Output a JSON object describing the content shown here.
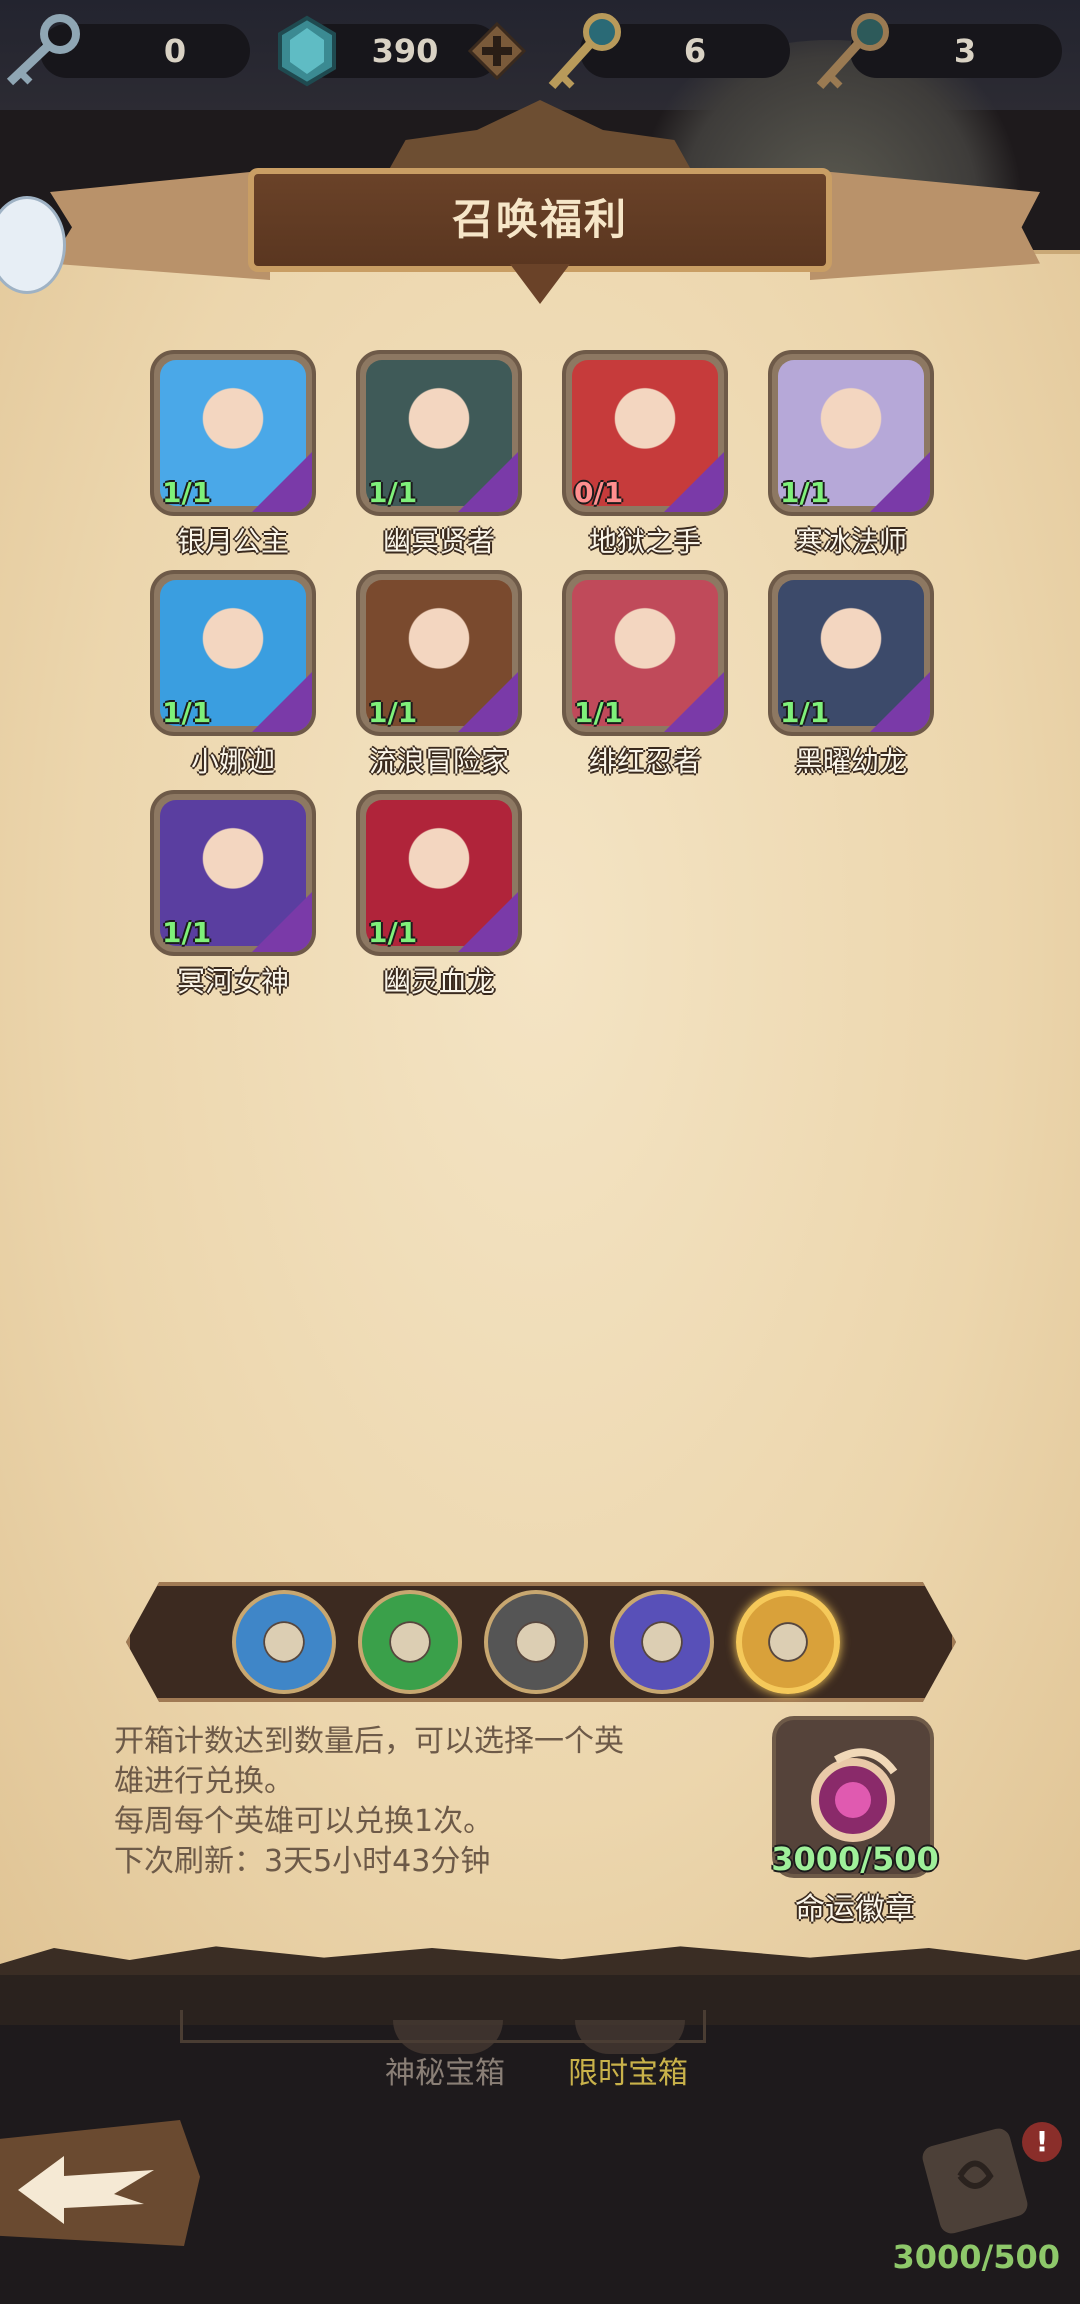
{
  "currencies": [
    {
      "icon": "silver-key-icon",
      "value": "0"
    },
    {
      "icon": "gem-icon",
      "value": "390"
    },
    {
      "icon": "teal-key-icon",
      "value": "6"
    },
    {
      "icon": "bronze-key-icon",
      "value": "3"
    }
  ],
  "banner": {
    "title": "召唤福利"
  },
  "heroes": [
    {
      "name": "银月公主",
      "count": "1/1",
      "color": "#4aa8e8"
    },
    {
      "name": "幽冥贤者",
      "count": "1/1",
      "color": "#3f5a58"
    },
    {
      "name": "地狱之手",
      "count": "0/1",
      "color": "#c63b3b"
    },
    {
      "name": "寒冰法师",
      "count": "1/1",
      "color": "#b6a8d8"
    },
    {
      "name": "小娜迦",
      "count": "1/1",
      "color": "#3a9ee0"
    },
    {
      "name": "流浪冒险家",
      "count": "1/1",
      "color": "#7a4a2e"
    },
    {
      "name": "绯红忍者",
      "count": "1/1",
      "color": "#c04a5a"
    },
    {
      "name": "黑曜幼龙",
      "count": "1/1",
      "color": "#3c4a6a"
    },
    {
      "name": "冥河女神",
      "count": "1/1",
      "color": "#5a3ea0"
    },
    {
      "name": "幽灵血龙",
      "count": "1/1",
      "color": "#b0243a"
    }
  ],
  "categories": [
    {
      "icon": "crown-icon",
      "color": "#3f86c8"
    },
    {
      "icon": "moon-icon",
      "color": "#3aa04a"
    },
    {
      "icon": "eye-icon",
      "color": "#555555"
    },
    {
      "icon": "flame-spirit-icon",
      "color": "#5850b8"
    },
    {
      "icon": "winged-emblem-icon",
      "color": "#d9a13a"
    }
  ],
  "info": {
    "line1": "开箱计数达到数量后，可以选择一个英",
    "line2": "雄进行兑换。",
    "line3": "每周每个英雄可以兑换1次。",
    "line4": "下次刷新：3天5小时43分钟"
  },
  "badge": {
    "count": "3000/500",
    "name": "命运徽章"
  },
  "nav": {
    "tab_mystery": "神秘宝箱",
    "tab_limited": "限时宝箱",
    "alert": "!",
    "bottom_count": "3000/500"
  },
  "colors": {
    "accent_green": "#7ff07a",
    "active_tab": "#c9b24a",
    "inactive_tab": "#8a7f76"
  }
}
